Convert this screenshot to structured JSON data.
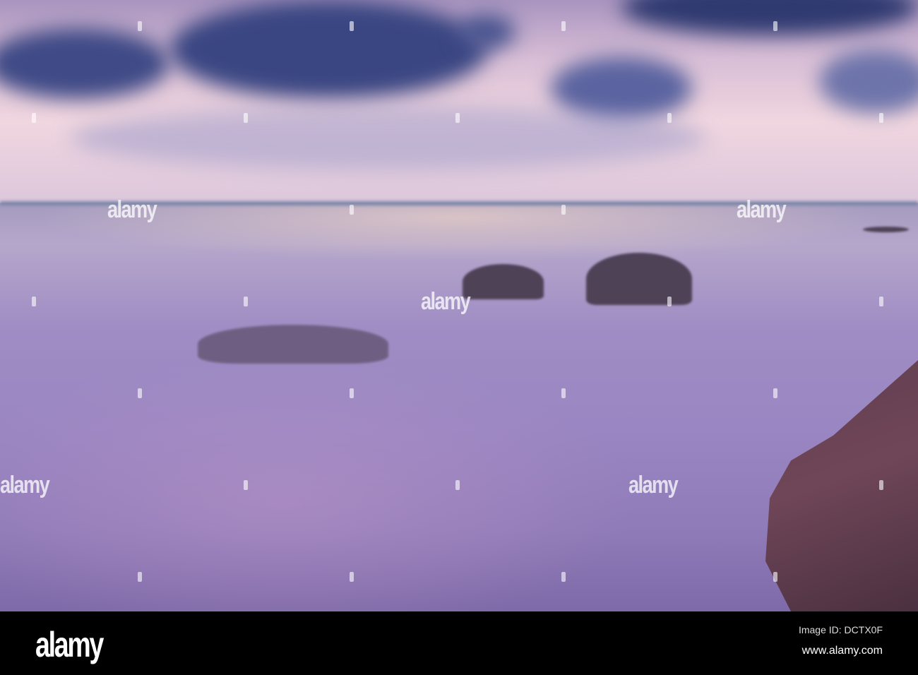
{
  "watermark": "alamy",
  "footer": {
    "logo": "alamy",
    "image_id": "Image ID: DCTX0F",
    "url": "www.alamy.com"
  }
}
